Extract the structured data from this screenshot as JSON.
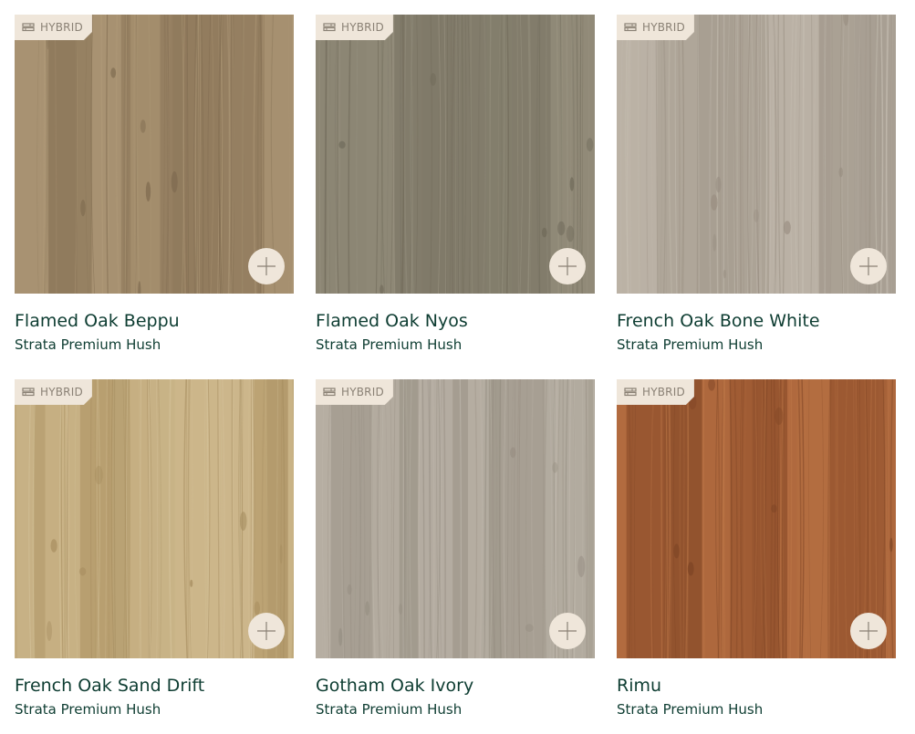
{
  "products": [
    {
      "title": "Flamed Oak Beppu",
      "subtitle": "Strata Premium Hush",
      "badge": "HYBRID",
      "badge_icon": "hybrid-planks-icon",
      "add_icon": "plus-icon",
      "colors": {
        "base": "#a08a6a",
        "light": "#b39d7c",
        "dark": "#7e6a4f"
      }
    },
    {
      "title": "Flamed Oak Nyos",
      "subtitle": "Strata Premium Hush",
      "badge": "HYBRID",
      "badge_icon": "hybrid-planks-icon",
      "add_icon": "plus-icon",
      "colors": {
        "base": "#8a8472",
        "light": "#9c9684",
        "dark": "#6e6858"
      }
    },
    {
      "title": "French Oak Bone White",
      "subtitle": "Strata Premium Hush",
      "badge": "HYBRID",
      "badge_icon": "hybrid-planks-icon",
      "add_icon": "plus-icon",
      "colors": {
        "base": "#b6ada0",
        "light": "#c9c2b6",
        "dark": "#978d80"
      }
    },
    {
      "title": "French Oak Sand Drift",
      "subtitle": "Strata Premium Hush",
      "badge": "HYBRID",
      "badge_icon": "hybrid-planks-icon",
      "add_icon": "plus-icon",
      "colors": {
        "base": "#c2aa7c",
        "light": "#d6c49c",
        "dark": "#a38a5c"
      }
    },
    {
      "title": "Gotham Oak Ivory",
      "subtitle": "Strata Premium Hush",
      "badge": "HYBRID",
      "badge_icon": "hybrid-planks-icon",
      "add_icon": "plus-icon",
      "colors": {
        "base": "#b0a89c",
        "light": "#c2bbb0",
        "dark": "#938b7f"
      }
    },
    {
      "title": "Rimu",
      "subtitle": "Strata Premium Hush",
      "badge": "HYBRID",
      "badge_icon": "hybrid-planks-icon",
      "add_icon": "plus-icon",
      "colors": {
        "base": "#a86238",
        "light": "#c07a4a",
        "dark": "#7d4424"
      }
    }
  ],
  "accent_colors": {
    "title_text": "#0e3d32",
    "badge_bg": "#efe6da",
    "icon": "#8a8175"
  }
}
